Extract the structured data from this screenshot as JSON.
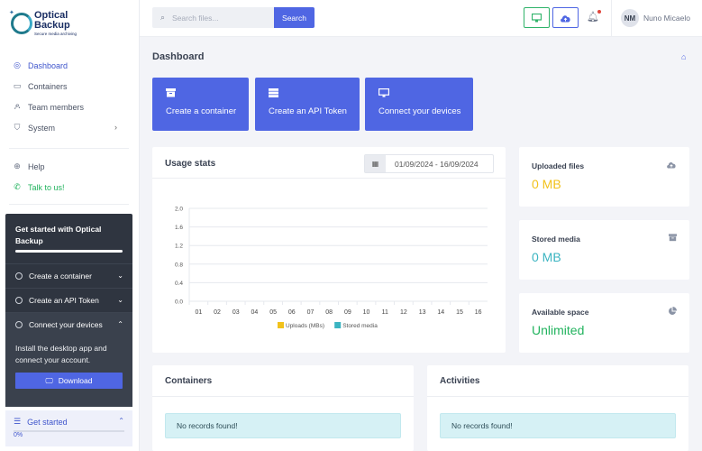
{
  "app": {
    "logo_line1": "Optical",
    "logo_line2": "Backup",
    "logo_tagline": "Secure media archiving"
  },
  "sidebar": {
    "items": [
      {
        "label": "Dashboard",
        "icon": "dashboard-icon",
        "active": true
      },
      {
        "label": "Containers",
        "icon": "archive-icon"
      },
      {
        "label": "Team members",
        "icon": "users-icon"
      },
      {
        "label": "System",
        "icon": "shield-icon",
        "has_chevron": true
      }
    ],
    "secondary": [
      {
        "label": "Help",
        "icon": "lifebuoy-icon"
      },
      {
        "label": "Talk to us!",
        "icon": "whatsapp-icon"
      }
    ]
  },
  "get_started": {
    "title": "Get started with Optical Backup",
    "steps": [
      {
        "label": "Create a container",
        "expanded": false
      },
      {
        "label": "Create an API Token",
        "expanded": false
      },
      {
        "label": "Connect your devices",
        "expanded": true
      }
    ],
    "expanded_text": "Install the desktop app and connect your account.",
    "download_label": "Download",
    "footer_label": "Get started",
    "progress_text": "0%",
    "progress": 0
  },
  "topbar": {
    "search_placeholder": "Search files...",
    "search_button": "Search",
    "user_initials": "NM",
    "user_name": "Nuno Micaelo",
    "notification_dot_color": "#e0453c"
  },
  "page": {
    "title": "Dashboard"
  },
  "actions": [
    {
      "label": "Create a container",
      "icon": "archive-icon"
    },
    {
      "label": "Create an API Token",
      "icon": "server-icon"
    },
    {
      "label": "Connect your devices",
      "icon": "monitor-icon"
    }
  ],
  "usage": {
    "title": "Usage stats",
    "date_range": "01/09/2024 - 16/09/2024"
  },
  "stats": [
    {
      "label": "Uploaded files",
      "value": "0 MB",
      "color": "#f2c21b",
      "icon": "cloud-upload-icon"
    },
    {
      "label": "Stored media",
      "value": "0 MB",
      "color": "#3bb4c1",
      "icon": "archive-icon"
    },
    {
      "label": "Available space",
      "value": "Unlimited",
      "color": "#22b35e",
      "icon": "pie-chart-icon"
    }
  ],
  "containers": {
    "title": "Containers",
    "empty": "No records found!"
  },
  "activities": {
    "title": "Activities",
    "empty": "No records found!"
  },
  "chart_data": {
    "type": "bar",
    "categories": [
      "01",
      "02",
      "03",
      "04",
      "05",
      "06",
      "07",
      "08",
      "09",
      "10",
      "11",
      "12",
      "13",
      "14",
      "15",
      "16"
    ],
    "series": [
      {
        "name": "Uploads (MBs)",
        "color": "#f2c21b",
        "values": [
          0,
          0,
          0,
          0,
          0,
          0,
          0,
          0,
          0,
          0,
          0,
          0,
          0,
          0,
          0,
          0
        ]
      },
      {
        "name": "Stored media",
        "color": "#3bb4c1",
        "values": [
          0,
          0,
          0,
          0,
          0,
          0,
          0,
          0,
          0,
          0,
          0,
          0,
          0,
          0,
          0,
          0
        ]
      }
    ],
    "yticks": [
      "0.0",
      "0.4",
      "0.8",
      "1.2",
      "1.6",
      "2.0"
    ],
    "ylim": [
      0,
      2.0
    ],
    "grid": true,
    "legend": "bottom"
  }
}
